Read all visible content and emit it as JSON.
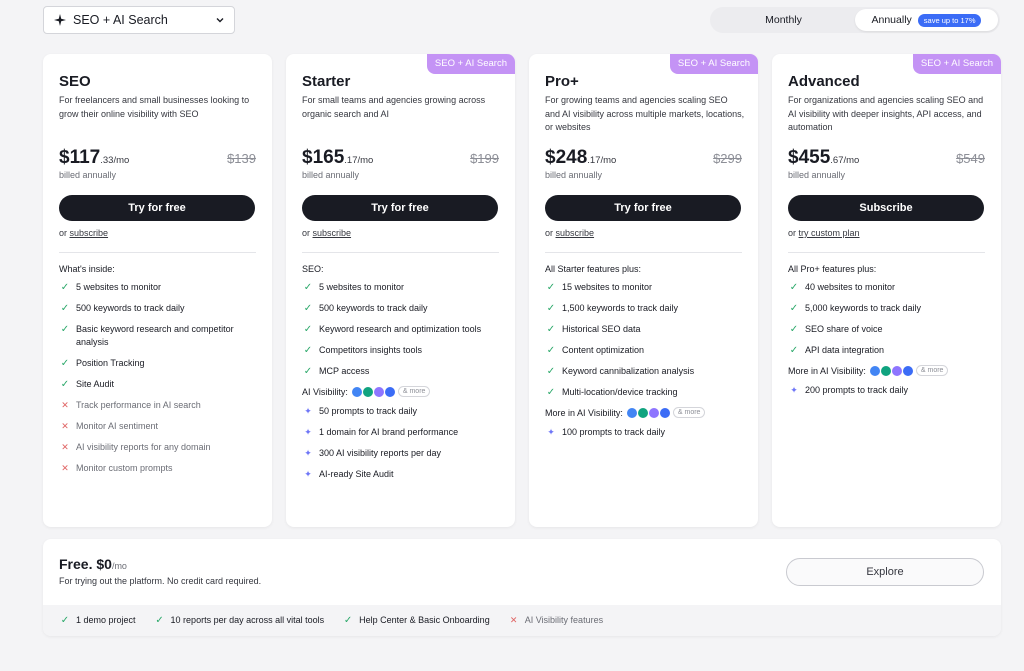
{
  "product_select": {
    "label": "SEO + AI Search"
  },
  "billing": {
    "monthly": "Monthly",
    "annual": "Annually",
    "save_badge": "save up to 17%"
  },
  "badge_label": "SEO + AI Search",
  "plans": [
    {
      "name": "SEO",
      "desc": "For freelancers and small businesses looking to grow their online visibility with SEO",
      "price_main": "$117",
      "price_cents": ".33/mo",
      "price_old": "$139",
      "billed": "billed annually",
      "cta": "Try for free",
      "or_prefix": "or",
      "or_link": "subscribe",
      "section_title": "What's inside:",
      "features": [
        {
          "text": "5 websites to monitor",
          "mark": "check"
        },
        {
          "text": "500 keywords to track daily",
          "mark": "check"
        },
        {
          "text": "Basic keyword research and competitor analysis",
          "mark": "check"
        },
        {
          "text": "Position Tracking",
          "mark": "check"
        },
        {
          "text": "Site Audit",
          "mark": "check"
        },
        {
          "text": "Track performance in AI search",
          "mark": "cross"
        },
        {
          "text": "Monitor AI sentiment",
          "mark": "cross"
        },
        {
          "text": "AI visibility reports for any domain",
          "mark": "cross"
        },
        {
          "text": "Monitor custom prompts",
          "mark": "cross"
        }
      ]
    },
    {
      "name": "Starter",
      "desc": "For small teams and agencies growing across organic search and AI",
      "price_main": "$165",
      "price_cents": ".17/mo",
      "price_old": "$199",
      "billed": "billed annually",
      "cta": "Try for free",
      "or_prefix": "or",
      "or_link": "subscribe",
      "section_title": "SEO:",
      "features": [
        {
          "text": "5 websites to monitor",
          "mark": "check"
        },
        {
          "text": "500 keywords to track daily",
          "mark": "check"
        },
        {
          "text": "Keyword research and optimization tools",
          "mark": "check"
        },
        {
          "text": "Competitors insights tools",
          "mark": "check"
        },
        {
          "text": "MCP access",
          "mark": "check"
        }
      ],
      "ai_title": "AI Visibility:",
      "ai_more": "& more",
      "ai_features": [
        {
          "text": "50 prompts to track daily",
          "mark": "spark"
        },
        {
          "text": "1 domain for AI brand performance",
          "mark": "spark"
        },
        {
          "text": "300 AI visibility reports per day",
          "mark": "spark"
        },
        {
          "text": "AI-ready Site Audit",
          "mark": "spark"
        }
      ]
    },
    {
      "name": "Pro+",
      "desc": "For growing teams and agencies scaling SEO and AI visibility across multiple markets, locations, or websites",
      "price_main": "$248",
      "price_cents": ".17/mo",
      "price_old": "$299",
      "billed": "billed annually",
      "cta": "Try for free",
      "or_prefix": "or",
      "or_link": "subscribe",
      "section_title": "All Starter features plus:",
      "features": [
        {
          "text": "15 websites to monitor",
          "mark": "check"
        },
        {
          "text": "1,500 keywords to track daily",
          "mark": "check"
        },
        {
          "text": "Historical SEO data",
          "mark": "check"
        },
        {
          "text": "Content optimization",
          "mark": "check"
        },
        {
          "text": "Keyword cannibalization analysis",
          "mark": "check"
        },
        {
          "text": "Multi-location/device tracking",
          "mark": "check"
        }
      ],
      "ai_title": "More in AI Visibility:",
      "ai_more": "& more",
      "ai_features": [
        {
          "text": "100 prompts to track daily",
          "mark": "spark"
        }
      ]
    },
    {
      "name": "Advanced",
      "desc": "For organizations and agencies scaling SEO and AI visibility with deeper insights, API access, and automation",
      "price_main": "$455",
      "price_cents": ".67/mo",
      "price_old": "$549",
      "billed": "billed annually",
      "cta": "Subscribe",
      "or_prefix": "or",
      "or_link": "try custom plan",
      "section_title": "All Pro+ features plus:",
      "features": [
        {
          "text": "40 websites to monitor",
          "mark": "check"
        },
        {
          "text": "5,000 keywords to track daily",
          "mark": "check"
        },
        {
          "text": "SEO share of voice",
          "mark": "check"
        },
        {
          "text": "API data integration",
          "mark": "check"
        }
      ],
      "ai_title": "More in AI Visibility:",
      "ai_more": "& more",
      "ai_features": [
        {
          "text": "200 prompts to track daily",
          "mark": "spark"
        }
      ]
    }
  ],
  "free": {
    "title": "Free.",
    "price": "$0",
    "per": "/mo",
    "desc": "For trying out the platform. No credit card required.",
    "cta": "Explore",
    "features": [
      {
        "text": "1 demo project",
        "mark": "check"
      },
      {
        "text": "10 reports per day across all vital tools",
        "mark": "check"
      },
      {
        "text": "Help Center & Basic Onboarding",
        "mark": "check"
      },
      {
        "text": "AI Visibility features",
        "mark": "cross"
      }
    ]
  },
  "colors": {
    "accent_purple": "#c493f5",
    "check_green": "#2aa869",
    "cross_red": "#e06464",
    "spark_blue": "#6e76f7",
    "dark_button": "#191b23",
    "save_badge": "#3b6cf6"
  }
}
